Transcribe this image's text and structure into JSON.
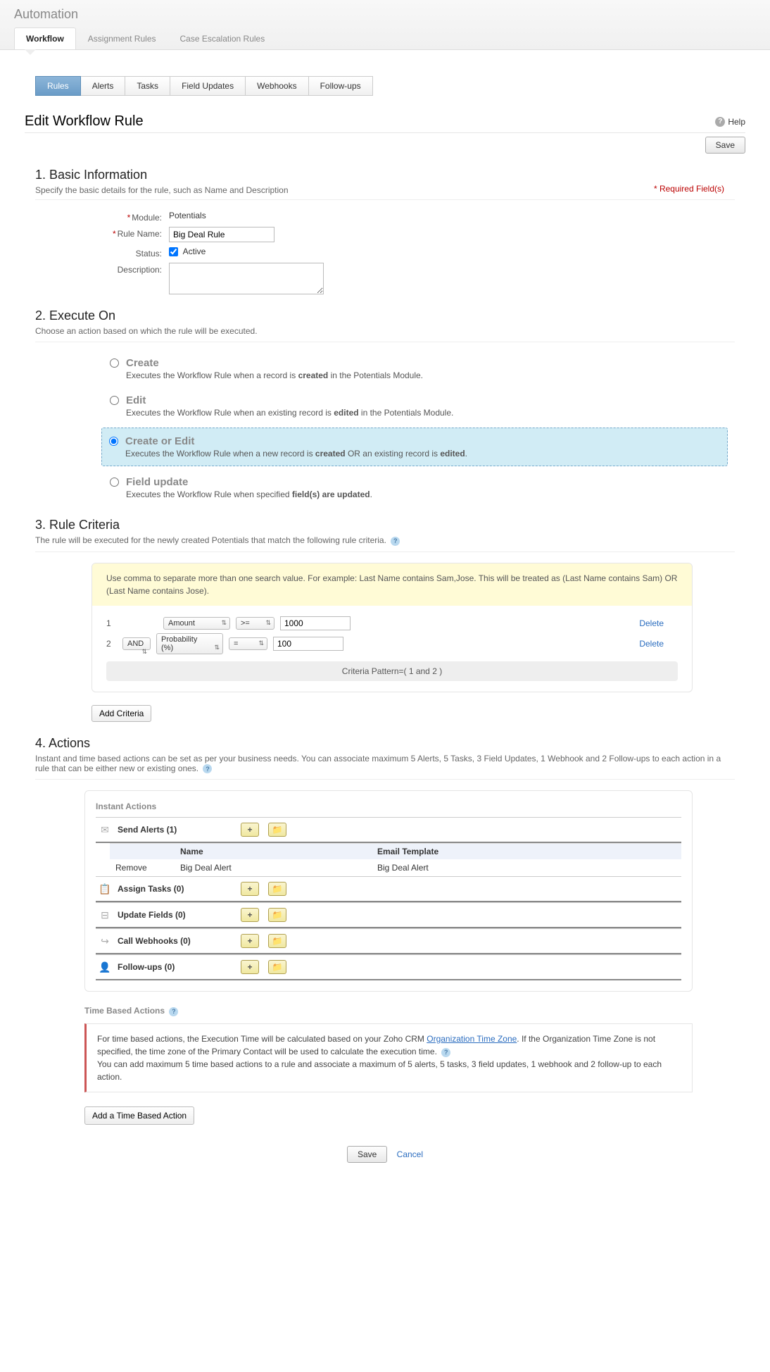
{
  "header": {
    "title": "Automation",
    "tabs": [
      "Workflow",
      "Assignment Rules",
      "Case Escalation Rules"
    ],
    "activeTab": 0
  },
  "subTabs": {
    "items": [
      "Rules",
      "Alerts",
      "Tasks",
      "Field Updates",
      "Webhooks",
      "Follow-ups"
    ],
    "activeIndex": 0
  },
  "page": {
    "title": "Edit Workflow Rule",
    "help": "Help",
    "saveBtn": "Save",
    "cancel": "Cancel",
    "requiredNote": "* Required Field(s)"
  },
  "basic": {
    "title": "1. Basic Information",
    "sub": "Specify the basic details for the rule, such as Name and Description",
    "moduleLabel": "Module:",
    "moduleValue": "Potentials",
    "ruleNameLabel": "Rule Name:",
    "ruleNameValue": "Big Deal Rule",
    "statusLabel": "Status:",
    "statusValue": "Active",
    "descLabel": "Description:",
    "descValue": ""
  },
  "execute": {
    "title": "2. Execute On",
    "sub": "Choose an action based on which the rule will be executed.",
    "options": [
      {
        "label": "Create",
        "desc_pre": "Executes the Workflow Rule when a record is ",
        "desc_bold": "created",
        "desc_post": " in the Potentials Module."
      },
      {
        "label": "Edit",
        "desc_pre": "Executes the Workflow Rule when an existing record is ",
        "desc_bold": "edited",
        "desc_post": " in the Potentials Module."
      },
      {
        "label": "Create or Edit",
        "desc_pre": "Executes the Workflow Rule when a new record is ",
        "desc_bold": "created",
        "desc_mid": " OR an existing record is ",
        "desc_bold2": "edited",
        "desc_post": "."
      },
      {
        "label": "Field update",
        "desc_pre": "Executes the Workflow Rule when specified ",
        "desc_bold": "field(s) are updated",
        "desc_post": "."
      }
    ],
    "selectedIndex": 2
  },
  "criteria": {
    "title": "3. Rule Criteria",
    "sub": "The rule will be executed for the newly created Potentials that match the following rule criteria.",
    "hint": "Use comma to separate more than one search value. For example: Last Name contains Sam,Jose. This will be treated as (Last Name contains Sam) OR (Last Name contains Jose).",
    "rows": [
      {
        "num": "1",
        "logic": "",
        "field": "Amount",
        "op": ">=",
        "value": "1000",
        "delete": "Delete"
      },
      {
        "num": "2",
        "logic": "AND",
        "field": "Probability (%)",
        "op": "=",
        "value": "100",
        "delete": "Delete"
      }
    ],
    "pattern": "Criteria Pattern=( 1 and 2 )",
    "addBtn": "Add Criteria"
  },
  "actions": {
    "title": "4. Actions",
    "sub": "Instant and time based actions can be set as per your business needs. You can associate maximum 5 Alerts, 5 Tasks, 3 Field Updates, 1 Webhook and 2 Follow-ups to each action in a rule that can be either new or existing ones.",
    "instantTitle": "Instant Actions",
    "rows": [
      {
        "icon": "✉",
        "label": "Send Alerts (1)"
      },
      {
        "icon": "📋",
        "label": "Assign Tasks (0)"
      },
      {
        "icon": "⊟",
        "label": "Update Fields (0)"
      },
      {
        "icon": "↪",
        "label": "Call Webhooks (0)"
      },
      {
        "icon": "👤",
        "label": "Follow-ups (0)"
      }
    ],
    "alertsTable": {
      "hName": "Name",
      "hTemplate": "Email Template",
      "row": {
        "remove": "Remove",
        "name": "Big Deal Alert",
        "template": "Big Deal Alert"
      }
    },
    "timeTitle": "Time Based Actions",
    "timeNote1a": "For time based actions, the Execution Time will be calculated based on your Zoho CRM ",
    "timeLink": "Organization Time Zone",
    "timeNote1b": ". If the Organization Time Zone is not specified, the time zone of the Primary Contact will be used to calculate the execution time.",
    "timeNote2": "You can add maximum 5 time based actions to a rule and associate a maximum of 5 alerts, 5 tasks, 3 field updates, 1 webhook and 2 follow-up to each action.",
    "addTimeBtn": "Add a Time Based Action"
  }
}
